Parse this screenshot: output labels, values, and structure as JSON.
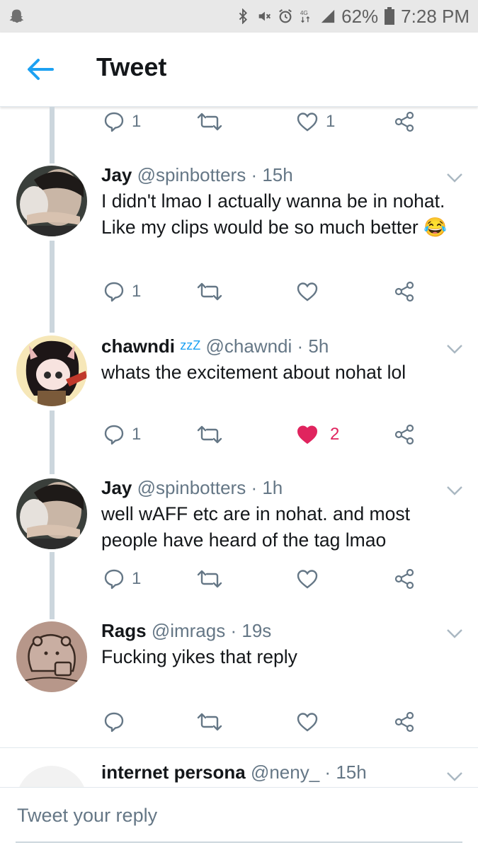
{
  "status_bar": {
    "battery": "62%",
    "time": "7:28 PM",
    "network": "4G"
  },
  "app_bar": {
    "title": "Tweet"
  },
  "top_actions": {
    "reply_count": "1",
    "like_count": "1"
  },
  "tweets": [
    {
      "name": "Jay",
      "handle": "@spinbotters",
      "dot": "·",
      "time": "15h",
      "text": "I didn't lmao I actually wanna be in nohat. Like my clips would be so much better 😂",
      "reply_count": "1",
      "like_count": "",
      "liked": false
    },
    {
      "name": "chawndi",
      "name_badge": "zzZ",
      "handle": "@chawndi",
      "dot": "·",
      "time": "5h",
      "text": "whats the excitement about nohat lol",
      "reply_count": "1",
      "like_count": "2",
      "liked": true
    },
    {
      "name": "Jay",
      "handle": "@spinbotters",
      "dot": "·",
      "time": "1h",
      "text": "well wAFF etc are in nohat. and most people have heard of the tag lmao",
      "reply_count": "1",
      "like_count": "",
      "liked": false
    },
    {
      "name": "Rags",
      "handle": "@imrags",
      "dot": "·",
      "time": "19s",
      "text": "Fucking yikes that reply",
      "reply_count": "",
      "like_count": "",
      "liked": false
    },
    {
      "name": "internet persona",
      "handle": "@neny_",
      "dot": "·",
      "time": "15h",
      "text": ""
    }
  ],
  "reply_box": {
    "placeholder": "Tweet your reply"
  },
  "colors": {
    "accent": "#1da1f2",
    "like": "#e0245e",
    "muted": "#657786",
    "thread": "#ccd6dd"
  },
  "icons": {
    "back": "arrow-left-icon",
    "reply": "comment-icon",
    "retweet": "retweet-icon",
    "like": "heart-icon",
    "share": "share-icon",
    "more": "chevron-down-icon"
  }
}
